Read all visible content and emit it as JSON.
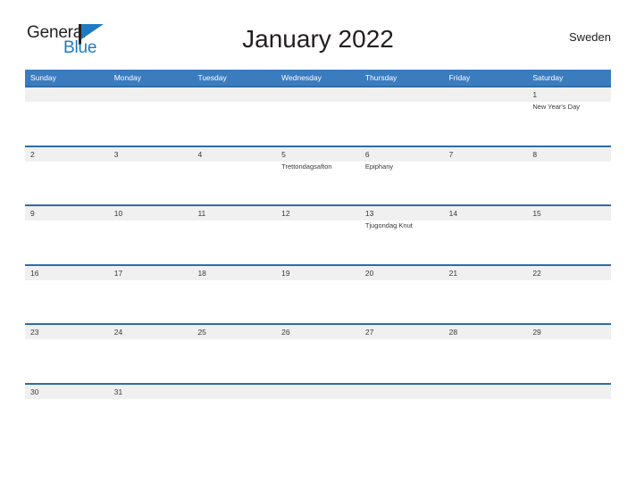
{
  "logo": {
    "text_top": "General",
    "text_bottom": "Blue",
    "flag_color": "#1f7bc1",
    "text_color": "#231f20"
  },
  "header": {
    "title": "January 2022",
    "region": "Sweden"
  },
  "theme": {
    "header_blue": "#3b7cbf",
    "row_line_blue": "#2f6ca8",
    "band_gray": "#f0f0f0",
    "text_dark": "#3a3a3a"
  },
  "weekdays": [
    "Sunday",
    "Monday",
    "Tuesday",
    "Wednesday",
    "Thursday",
    "Friday",
    "Saturday"
  ],
  "weeks": [
    [
      {
        "date": "",
        "events": []
      },
      {
        "date": "",
        "events": []
      },
      {
        "date": "",
        "events": []
      },
      {
        "date": "",
        "events": []
      },
      {
        "date": "",
        "events": []
      },
      {
        "date": "",
        "events": []
      },
      {
        "date": "1",
        "events": [
          "New Year's Day"
        ]
      }
    ],
    [
      {
        "date": "2",
        "events": []
      },
      {
        "date": "3",
        "events": []
      },
      {
        "date": "4",
        "events": []
      },
      {
        "date": "5",
        "events": [
          "Trettondagsafton"
        ]
      },
      {
        "date": "6",
        "events": [
          "Epiphany"
        ]
      },
      {
        "date": "7",
        "events": []
      },
      {
        "date": "8",
        "events": []
      }
    ],
    [
      {
        "date": "9",
        "events": []
      },
      {
        "date": "10",
        "events": []
      },
      {
        "date": "11",
        "events": []
      },
      {
        "date": "12",
        "events": []
      },
      {
        "date": "13",
        "events": [
          "Tjugondag Knut"
        ]
      },
      {
        "date": "14",
        "events": []
      },
      {
        "date": "15",
        "events": []
      }
    ],
    [
      {
        "date": "16",
        "events": []
      },
      {
        "date": "17",
        "events": []
      },
      {
        "date": "18",
        "events": []
      },
      {
        "date": "19",
        "events": []
      },
      {
        "date": "20",
        "events": []
      },
      {
        "date": "21",
        "events": []
      },
      {
        "date": "22",
        "events": []
      }
    ],
    [
      {
        "date": "23",
        "events": []
      },
      {
        "date": "24",
        "events": []
      },
      {
        "date": "25",
        "events": []
      },
      {
        "date": "26",
        "events": []
      },
      {
        "date": "27",
        "events": []
      },
      {
        "date": "28",
        "events": []
      },
      {
        "date": "29",
        "events": []
      }
    ],
    [
      {
        "date": "30",
        "events": []
      },
      {
        "date": "31",
        "events": []
      },
      {
        "date": "",
        "events": []
      },
      {
        "date": "",
        "events": []
      },
      {
        "date": "",
        "events": []
      },
      {
        "date": "",
        "events": []
      },
      {
        "date": "",
        "events": []
      }
    ]
  ]
}
